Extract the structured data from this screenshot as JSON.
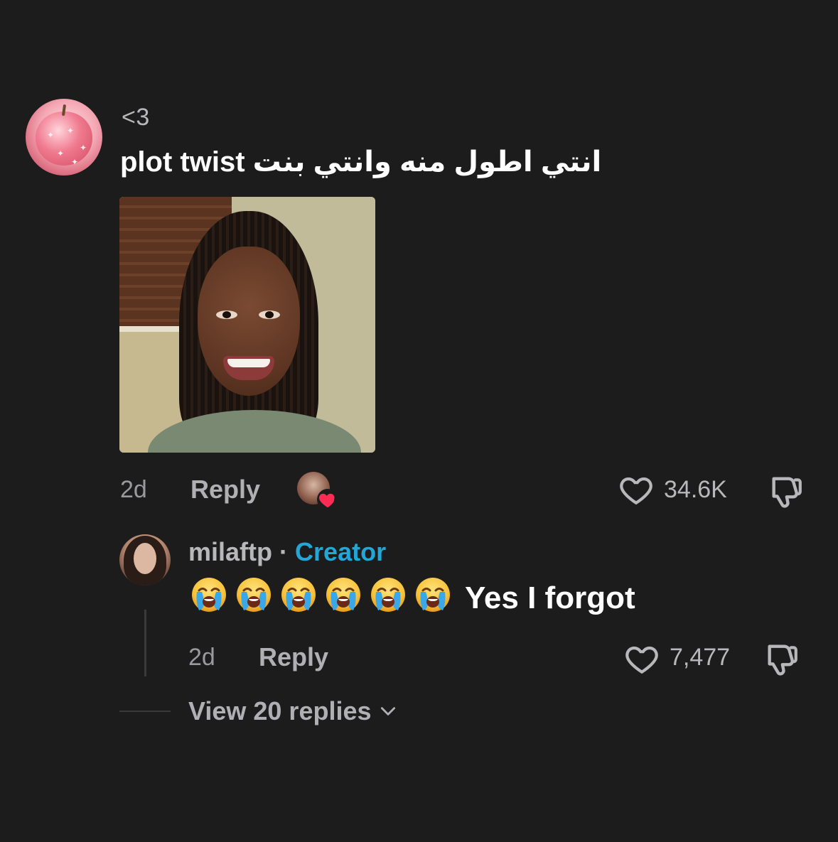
{
  "main_comment": {
    "username": "<3",
    "text": "انتي اطول منه وانتي بنت plot twist",
    "time": "2d",
    "reply_label": "Reply",
    "like_count": "34.6K",
    "image_description_alt": "reaction photo"
  },
  "reply_comment": {
    "username": "milaftp",
    "separator": "·",
    "badge": "Creator",
    "text": "Yes I forgot",
    "emoji_count": 6,
    "emoji": "loudly-crying-face",
    "time": "2d",
    "reply_label": "Reply",
    "like_count": "7,477"
  },
  "thread": {
    "view_replies_label": "View 20 replies"
  },
  "colors": {
    "background": "#1c1c1d",
    "creator_badge": "#22a7d6",
    "liked_heart": "#fe2c55"
  },
  "icons": {
    "like": "heart-outline-icon",
    "dislike": "thumbs-down-icon",
    "creator_liked": "creator-liked-heart-icon",
    "expand": "chevron-down-icon"
  }
}
